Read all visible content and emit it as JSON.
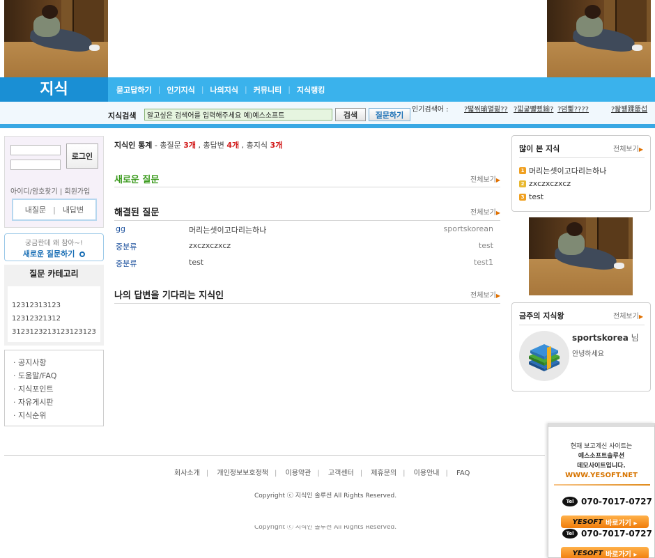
{
  "header": {
    "brand": "지식",
    "nav": [
      "묻고답하기",
      "인기지식",
      "나의지식",
      "커뮤니티",
      "지식랭킹"
    ]
  },
  "search": {
    "label": "지식검색",
    "value": "알고싶은 검색어를 입력해주세요 예)예스소프트",
    "search_button": "검색",
    "ask_button": "질문하기",
    "popular_label": "인기검색어 :",
    "popular_keywords": [
      "?뗣씪瑜멸쾶??",
      "?낇굹뼱삤鍮?",
      "?뎜삁????",
      "?돪붿蹂뚮섭"
    ]
  },
  "login": {
    "login_button": "로그인",
    "links": "아이디/암호찾기 | 회원가입",
    "my_question": "내질문",
    "my_answer": "내답변"
  },
  "ask_box": {
    "line1": "궁금한데 왜 참아~!",
    "line2": "새로운 질문하기"
  },
  "category": {
    "title": "질문 카테고리",
    "items": [
      "12312313123",
      "12312321312",
      "3123123213123123123"
    ]
  },
  "menu": [
    "· 공지사항",
    "· 도움말/FAQ",
    "· 지식포인트",
    "· 자유게시판",
    "· 지식순위"
  ],
  "stats": {
    "label": "지식인 통계",
    "text1": " - 총질문 ",
    "questions": "3개",
    "text2": " , 총답변 ",
    "answers": "4개",
    "text3": " , 총지식 ",
    "knowledge": "3개"
  },
  "sections": {
    "more": "전체보기",
    "new_questions": "새로운 질문",
    "solved_questions": "해결된 질문",
    "waiting": "나의 답변을 기다리는 지식인"
  },
  "solved_rows": [
    {
      "category": "gg",
      "title": "머리는셋이고다리는하나",
      "user": "sportskorean"
    },
    {
      "category": "중분류",
      "title": "zxczxczxcz",
      "user": "test"
    },
    {
      "category": "중분류",
      "title": "test",
      "user": "test1"
    }
  ],
  "most_viewed": {
    "title": "많이 본 지식",
    "more": "전체보기",
    "items": [
      "머리는셋이고다리는하나",
      "zxczxczxcz",
      "test"
    ],
    "icon_colors": [
      "#f0a020",
      "#e8b830",
      "#f0a020"
    ]
  },
  "weekly_king": {
    "title": "금주의 지식왕",
    "more": "전체보기",
    "name": "sportskorea",
    "suffix": " 님",
    "message": "안녕하세요"
  },
  "footer": {
    "links": [
      "회사소개",
      "개인정보보호정책",
      "이용약관",
      "고객센터",
      "제휴문의",
      "이용안내",
      "FAQ"
    ],
    "copyright": "Copyright ⓒ 지식인 솔루션 All Rights Reserved."
  },
  "banner": {
    "line1": "현재 보고계신 사이트는",
    "line2": "예스소프트솔루션",
    "line3": "데모사이트입니다.",
    "url": "WWW.YESOFT.NET",
    "tel_badge": "Tel",
    "phone": "070-7017-0727",
    "go_brand": "YESOFT",
    "go_label": "바로가기 ▸"
  },
  "colors": {
    "nav_blue": "#3ab2ec",
    "brand_blue": "#1a8fd4",
    "accent_red": "#d21b1b",
    "green_title": "#3a9a1c",
    "orange": "#e07000"
  }
}
